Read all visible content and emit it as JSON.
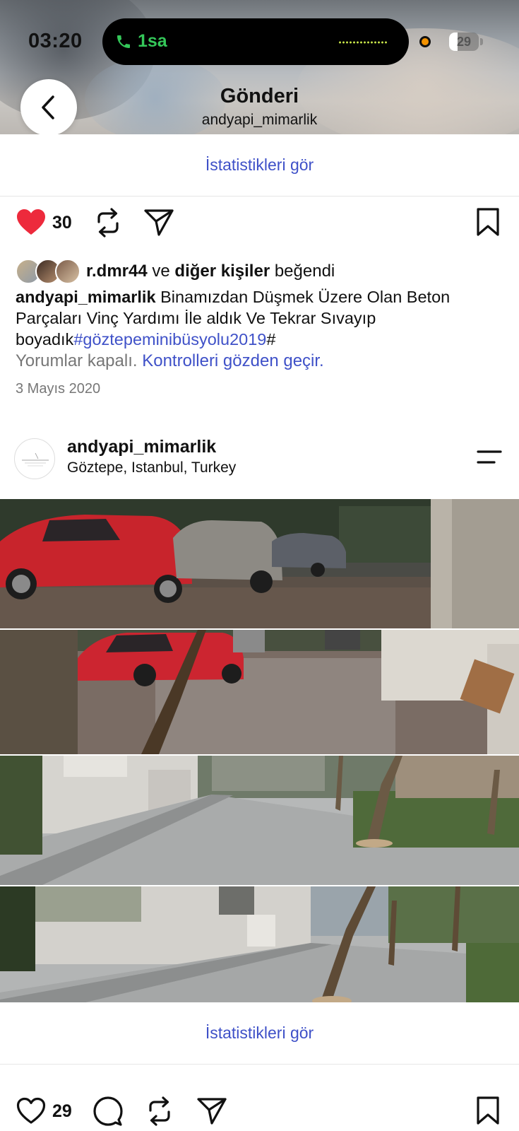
{
  "status_bar": {
    "time": "03:20",
    "call_duration": "1sa",
    "battery_level": "29",
    "battery_fraction": 0.29
  },
  "header": {
    "title": "Gönderi",
    "subtitle": "andyapi_mimarlik",
    "back_icon": "chevron-left-icon"
  },
  "post1": {
    "stats_link": "İstatistikleri gör",
    "like_count": "30",
    "liked_by": {
      "first_user": "r.dmr44",
      "connector": "ve",
      "others": "diğer kişiler",
      "suffix": "beğendi"
    },
    "caption": {
      "username": "andyapi_mimarlik",
      "text": "Binamızdan Düşmek Üzere Olan Beton Parçaları Vinç Yardımı İle aldık Ve Tekrar Sıvayıp boyadık",
      "hashtag": "#göztepeminibüsyolu2019",
      "trailing": "#"
    },
    "comments_off": "Yorumlar kapalı.",
    "review_controls": "Kontrolleri gözden geçir.",
    "date": "3 Mayıs 2020"
  },
  "post2": {
    "username": "andyapi_mimarlik",
    "location": "Göztepe, Istanbul, Turkey",
    "stats_link": "İstatistikleri gör",
    "like_count": "29"
  },
  "colors": {
    "link_blue": "#3f51c8",
    "like_red": "#ed2a3c",
    "call_green": "#34c759"
  }
}
